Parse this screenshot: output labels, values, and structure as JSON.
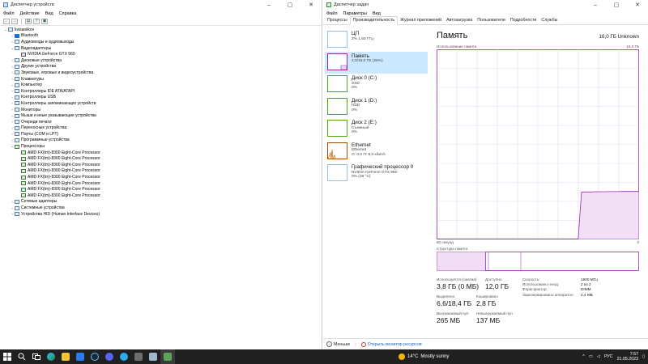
{
  "device_manager": {
    "title": "Диспетчер устройств",
    "menu": [
      "Файл",
      "Действие",
      "Вид",
      "Справка"
    ],
    "tree": [
      {
        "label": "kvisaniikov",
        "level": 0,
        "arrow": "⌄",
        "icon": "computer"
      },
      {
        "label": "Bluetooth",
        "level": 1,
        "arrow": "›",
        "icon": "bluetooth"
      },
      {
        "label": "Аудиовходы и аудиовыходы",
        "level": 1,
        "arrow": "›",
        "icon": "audio"
      },
      {
        "label": "Видеоадаптеры",
        "level": 1,
        "arrow": "⌄",
        "icon": "display"
      },
      {
        "label": "NVIDIA GeForce GTX 960",
        "level": 2,
        "arrow": "",
        "icon": "gpu"
      },
      {
        "label": "Дисковые устройства",
        "level": 1,
        "arrow": "›",
        "icon": "disk"
      },
      {
        "label": "Другие устройства",
        "level": 1,
        "arrow": "›",
        "icon": "other"
      },
      {
        "label": "Звуковые, игровые и видеоустройства",
        "level": 1,
        "arrow": "›",
        "icon": "sound"
      },
      {
        "label": "Клавиатуры",
        "level": 1,
        "arrow": "›",
        "icon": "keyboard"
      },
      {
        "label": "Компьютер",
        "level": 1,
        "arrow": "›",
        "icon": "computer"
      },
      {
        "label": "Контроллеры IDE ATA/ATAPI",
        "level": 1,
        "arrow": "›",
        "icon": "controller"
      },
      {
        "label": "Контроллеры USB",
        "level": 1,
        "arrow": "›",
        "icon": "usb"
      },
      {
        "label": "Контроллеры запоминающих устройств",
        "level": 1,
        "arrow": "›",
        "icon": "storage"
      },
      {
        "label": "Мониторы",
        "level": 1,
        "arrow": "›",
        "icon": "monitor"
      },
      {
        "label": "Мыши и иные указывающие устройства",
        "level": 1,
        "arrow": "›",
        "icon": "mouse"
      },
      {
        "label": "Очереди печати",
        "level": 1,
        "arrow": "›",
        "icon": "printer"
      },
      {
        "label": "Переносные устройства",
        "level": 1,
        "arrow": "›",
        "icon": "portable"
      },
      {
        "label": "Порты (COM и LPT)",
        "level": 1,
        "arrow": "›",
        "icon": "port"
      },
      {
        "label": "Программные устройства",
        "level": 1,
        "arrow": "›",
        "icon": "software"
      },
      {
        "label": "Процессоры",
        "level": 1,
        "arrow": "⌄",
        "icon": "cpu"
      },
      {
        "label": "AMD FX(tm)-8300 Eight-Core Processor",
        "level": 2,
        "arrow": "",
        "icon": "cpu"
      },
      {
        "label": "AMD FX(tm)-8300 Eight-Core Processor",
        "level": 2,
        "arrow": "",
        "icon": "cpu"
      },
      {
        "label": "AMD FX(tm)-8300 Eight-Core Processor",
        "level": 2,
        "arrow": "",
        "icon": "cpu"
      },
      {
        "label": "AMD FX(tm)-8300 Eight-Core Processor",
        "level": 2,
        "arrow": "",
        "icon": "cpu"
      },
      {
        "label": "AMD FX(tm)-8300 Eight-Core Processor",
        "level": 2,
        "arrow": "",
        "icon": "cpu"
      },
      {
        "label": "AMD FX(tm)-8300 Eight-Core Processor",
        "level": 2,
        "arrow": "",
        "icon": "cpu"
      },
      {
        "label": "AMD FX(tm)-8300 Eight-Core Processor",
        "level": 2,
        "arrow": "",
        "icon": "cpu"
      },
      {
        "label": "AMD FX(tm)-8300 Eight-Core Processor",
        "level": 2,
        "arrow": "",
        "icon": "cpu"
      },
      {
        "label": "Сетевые адаптеры",
        "level": 1,
        "arrow": "›",
        "icon": "network"
      },
      {
        "label": "Системные устройства",
        "level": 1,
        "arrow": "›",
        "icon": "system"
      },
      {
        "label": "Устройства HID (Human Interface Devices)",
        "level": 1,
        "arrow": "›",
        "icon": "hid"
      }
    ]
  },
  "task_manager": {
    "title": "Диспетчер задач",
    "menu": [
      "Файл",
      "Параметры",
      "Вид"
    ],
    "tabs": [
      "Процессы",
      "Производительность",
      "Журнал приложений",
      "Автозагрузка",
      "Пользователи",
      "Подробности",
      "Службы"
    ],
    "active_tab": 1,
    "resources": [
      {
        "name": "ЦП",
        "sub1": "2% 1,50 ГГц",
        "sub2": "",
        "kind": "cpu",
        "selected": false
      },
      {
        "name": "Память",
        "sub1": "4,0/16,0 ГБ (25%)",
        "sub2": "",
        "kind": "mem",
        "selected": true
      },
      {
        "name": "Диск 0 (C:)",
        "sub1": "SSD",
        "sub2": "0%",
        "kind": "disk",
        "selected": false
      },
      {
        "name": "Диск 1 (D:)",
        "sub1": "HDD",
        "sub2": "0%",
        "kind": "disk",
        "selected": false
      },
      {
        "name": "Диск 2 (E:)",
        "sub1": "Съемный",
        "sub2": "0%",
        "kind": "disk",
        "selected": false
      },
      {
        "name": "Ethernet",
        "sub1": "Ethernet",
        "sub2": "О: 0,0 П: 8,0 кбит/с",
        "kind": "eth",
        "selected": false
      },
      {
        "name": "Графический процессор 0",
        "sub1": "NVIDIA GeForce GTX 960",
        "sub2": "0% (28 °C)",
        "kind": "gpu",
        "selected": false
      }
    ],
    "detail": {
      "title": "Память",
      "total": "16,0 ГБ Unknown",
      "usage_label": "Использование памяти",
      "usage_max": "16,0 ГБ",
      "time_left": "60 секунд",
      "time_right": "0",
      "structure_label": "Структура памяти",
      "stats": {
        "in_use_label": "Используется (сжатая)",
        "in_use_value": "3,8 ГБ (0 МБ)",
        "available_label": "Доступно",
        "available_value": "12,0 ГБ",
        "committed_label": "Выделено",
        "committed_value": "6,6/18,4 ГБ",
        "cached_label": "Кэшировано",
        "cached_value": "2,8 ГБ",
        "paged_label": "Выгружаемый пул",
        "paged_value": "265 МБ",
        "nonpaged_label": "Невыгружаемый пул",
        "nonpaged_value": "137 МБ"
      },
      "kv": [
        {
          "k": "Скорость:",
          "v": "1600 МГц"
        },
        {
          "k": "Использовано гнезд:",
          "v": "2 из 2"
        },
        {
          "k": "Форм-фактор:",
          "v": "DIMM"
        },
        {
          "k": "Зарезервировано аппаратно:",
          "v": "2,4 МБ"
        }
      ]
    },
    "footer": {
      "less": "Меньше",
      "link": "Открыть монитор ресурсов"
    }
  },
  "taskbar": {
    "weather_temp": "14°C",
    "weather_text": "Mostly sunny",
    "lang": "РУС",
    "time": "7:57",
    "date": "21.05.2023"
  },
  "chart_data": {
    "type": "line",
    "series": [
      {
        "values": [
          0.0,
          0.0,
          0.0,
          0.0,
          0.0,
          0.0,
          0.0,
          0.0,
          0.0,
          0.0,
          0.0,
          0.0,
          0.0,
          0.0,
          0.0,
          0.0,
          0.0,
          0.0,
          0.0,
          0.0,
          0.0,
          0.0,
          0.0,
          0.0,
          0.0,
          0.0,
          0.0,
          0.0,
          0.0,
          0.0,
          0.0,
          0.0,
          0.0,
          0.0,
          0.0,
          0.0,
          0.0,
          0.0,
          0.0,
          0.0,
          0.0,
          0.0,
          0.0,
          3.98,
          3.98,
          3.98,
          3.98,
          4.0,
          4.0,
          4.0,
          4.0,
          4.01,
          4.01,
          4.01,
          4.01,
          4.02,
          4.02,
          4.02,
          4.02,
          4.02,
          4.02
        ]
      }
    ],
    "xlim": [
      60,
      0
    ],
    "ylim": [
      0,
      16
    ],
    "grid": true
  }
}
